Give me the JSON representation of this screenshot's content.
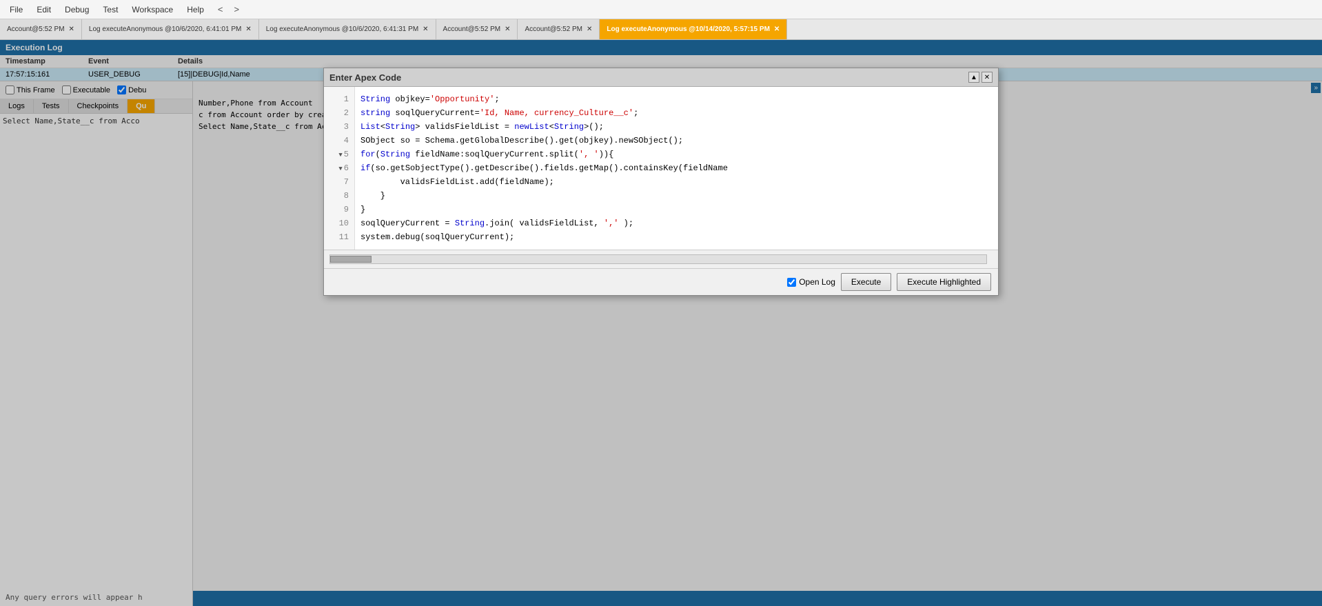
{
  "menubar": {
    "items": [
      "File",
      "Edit",
      "Debug",
      "Test",
      "Workspace",
      "Help"
    ],
    "nav_back": "<",
    "nav_forward": ">",
    "workspace_label": "Workspace"
  },
  "tabs": [
    {
      "label": "Account@5:52 PM",
      "active": false
    },
    {
      "label": "Log executeAnonymous @10/6/2020, 6:41:01 PM",
      "active": false
    },
    {
      "label": "Log executeAnonymous @10/6/2020, 6:41:31 PM",
      "active": false
    },
    {
      "label": "Account@5:52 PM",
      "active": false
    },
    {
      "label": "Account@5:52 PM",
      "active": false
    },
    {
      "label": "Log executeAnonymous @10/14/2020, 5:57:15 PM",
      "active": true
    }
  ],
  "execution_log": {
    "title": "Execution Log",
    "columns": [
      "Timestamp",
      "Event",
      "Details"
    ],
    "rows": [
      {
        "timestamp": "17:57:15:161",
        "event": "USER_DEBUG",
        "details": "[15]|DEBUG|Id,Name"
      }
    ]
  },
  "checkboxes": {
    "this_frame": {
      "label": "This Frame",
      "checked": false
    },
    "executable": {
      "label": "Executable",
      "checked": false
    },
    "debug": {
      "label": "Debu",
      "checked": true
    }
  },
  "bottom_tabs": [
    {
      "label": "Logs",
      "active": false
    },
    {
      "label": "Tests",
      "active": false
    },
    {
      "label": "Checkpoints",
      "active": false
    },
    {
      "label": "Qu",
      "active": true
    }
  ],
  "query_text": "Select Name,State__c from Acco",
  "query_error": "Any query errors will appear h",
  "results_list": [
    "Number,Phone from Account",
    "c from Account order by createddate",
    "Select Name,State__c from Account order by createddate D..."
  ],
  "modal": {
    "title": "Enter Apex Code",
    "lines": [
      {
        "num": 1,
        "has_triangle": false,
        "content": "String objkey='Opportunity';"
      },
      {
        "num": 2,
        "has_triangle": false,
        "content": "string soqlQueryCurrent='Id, Name, currency_Culture__c';"
      },
      {
        "num": 3,
        "has_triangle": false,
        "content": "List<String> validsFieldList = new List<String>();"
      },
      {
        "num": 4,
        "has_triangle": false,
        "content": "SObject so = Schema.getGlobalDescribe().get(objkey).newSObject();"
      },
      {
        "num": 5,
        "has_triangle": true,
        "content": "for(String fieldName:soqlQueryCurrent.split(', ')){"
      },
      {
        "num": 6,
        "has_triangle": true,
        "content": "    if(so.getSobjectType().getDescribe().fields.getMap().containsKey(fieldName"
      },
      {
        "num": 7,
        "has_triangle": false,
        "content": "        validsFieldList.add(fieldName);"
      },
      {
        "num": 8,
        "has_triangle": false,
        "content": "    }"
      },
      {
        "num": 9,
        "has_triangle": false,
        "content": "}"
      },
      {
        "num": 10,
        "has_triangle": false,
        "content": "soqlQueryCurrent = String.join( validsFieldList, ',' );"
      },
      {
        "num": 11,
        "has_triangle": false,
        "content": "system.debug(soqlQueryCurrent);"
      }
    ]
  },
  "action_bar": {
    "open_log_label": "Open Log",
    "execute_label": "Execute",
    "execute_highlighted_label": "Execute Highlighted"
  }
}
